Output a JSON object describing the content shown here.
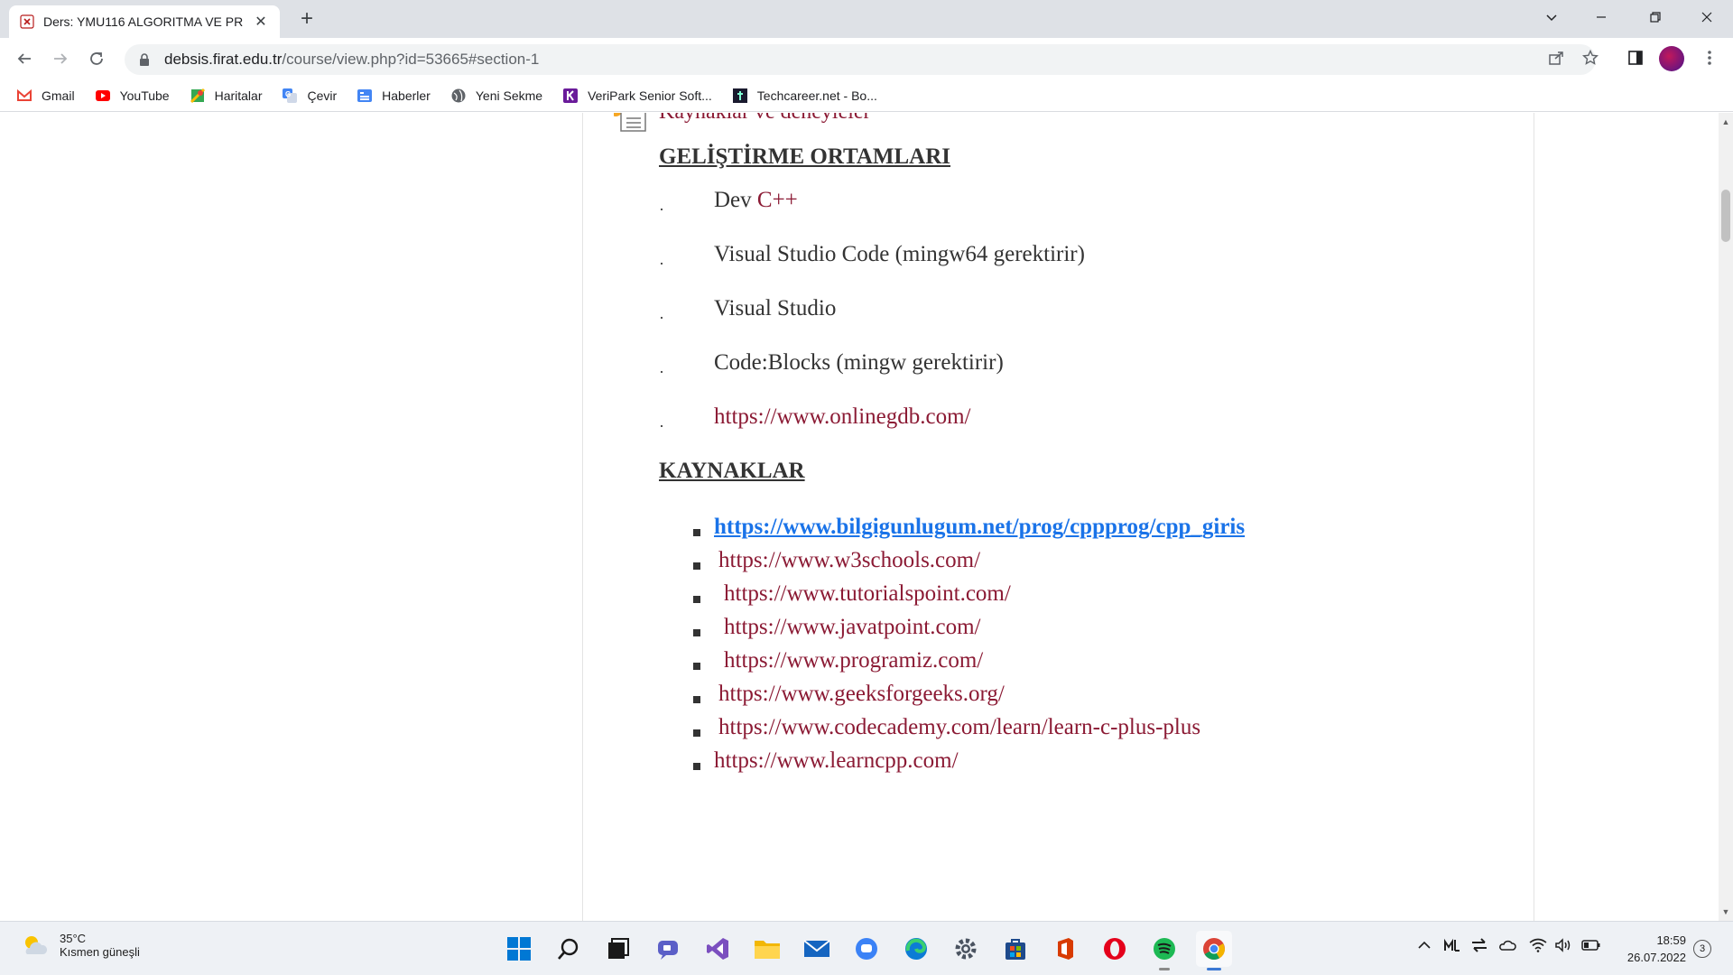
{
  "browser": {
    "tab_title": "Ders: YMU116 ALGORITMA VE PR",
    "url_host": "debsis.firat.edu.tr",
    "url_path": "/course/view.php?id=53665#section-1"
  },
  "bookmarks": [
    {
      "label": "Gmail",
      "icon": "gmail-icon",
      "color": "#ea4335"
    },
    {
      "label": "YouTube",
      "icon": "youtube-icon",
      "color": "#ff0000"
    },
    {
      "label": "Haritalar",
      "icon": "maps-icon",
      "color": "#34a853"
    },
    {
      "label": "Çevir",
      "icon": "translate-icon",
      "color": "#4285f4"
    },
    {
      "label": "Haberler",
      "icon": "news-icon",
      "color": "#4285f4"
    },
    {
      "label": "Yeni Sekme",
      "icon": "globe-icon",
      "color": "#5f6368"
    },
    {
      "label": "VeriPark Senior Soft...",
      "icon": "veripark-icon",
      "color": "#6a1b9a"
    },
    {
      "label": "Techcareer.net - Bo...",
      "icon": "techcareer-icon",
      "color": "#1a1a2e"
    }
  ],
  "page": {
    "partial_title": "Kaynaklar ve deneyleler",
    "dev_heading": "GELİŞTİRME ORTAMLARI",
    "dev_items": [
      {
        "prefix": "Dev ",
        "rest": "C++"
      },
      {
        "prefix": "Visual Studio Code  (mingw64 gerektirir)",
        "rest": ""
      },
      {
        "prefix": "Visual Studio",
        "rest": ""
      },
      {
        "prefix": "Code:Blocks (mingw gerektirir)",
        "rest": ""
      },
      {
        "prefix": "",
        "rest": "https://www.onlinegdb.com/"
      }
    ],
    "resources_heading": "KAYNAKLAR",
    "resources": [
      "https://www.bilgigunlugum.net/prog/cppprog/cpp_giris",
      "https://www.w3schools.com/",
      "https://www.tutorialspoint.com/",
      "https://www.javatpoint.com/",
      "https://www.programiz.com/",
      "https://www.geeksforgeeks.org/",
      "https://www.codecademy.com/learn/learn-c-plus-plus",
      "https://www.learncpp.com/"
    ]
  },
  "taskbar": {
    "weather_temp": "35°C",
    "weather_desc": "Kısmen güneşli",
    "time": "18:59",
    "date": "26.07.2022",
    "notifications": "3",
    "apps": [
      "windows-start-icon",
      "search-icon",
      "task-view-icon",
      "teams-chat-icon",
      "visual-studio-icon",
      "file-explorer-icon",
      "mail-icon",
      "messaging-icon",
      "edge-icon",
      "settings-icon",
      "store-icon",
      "office-icon",
      "opera-icon",
      "spotify-icon",
      "chrome-icon"
    ]
  }
}
